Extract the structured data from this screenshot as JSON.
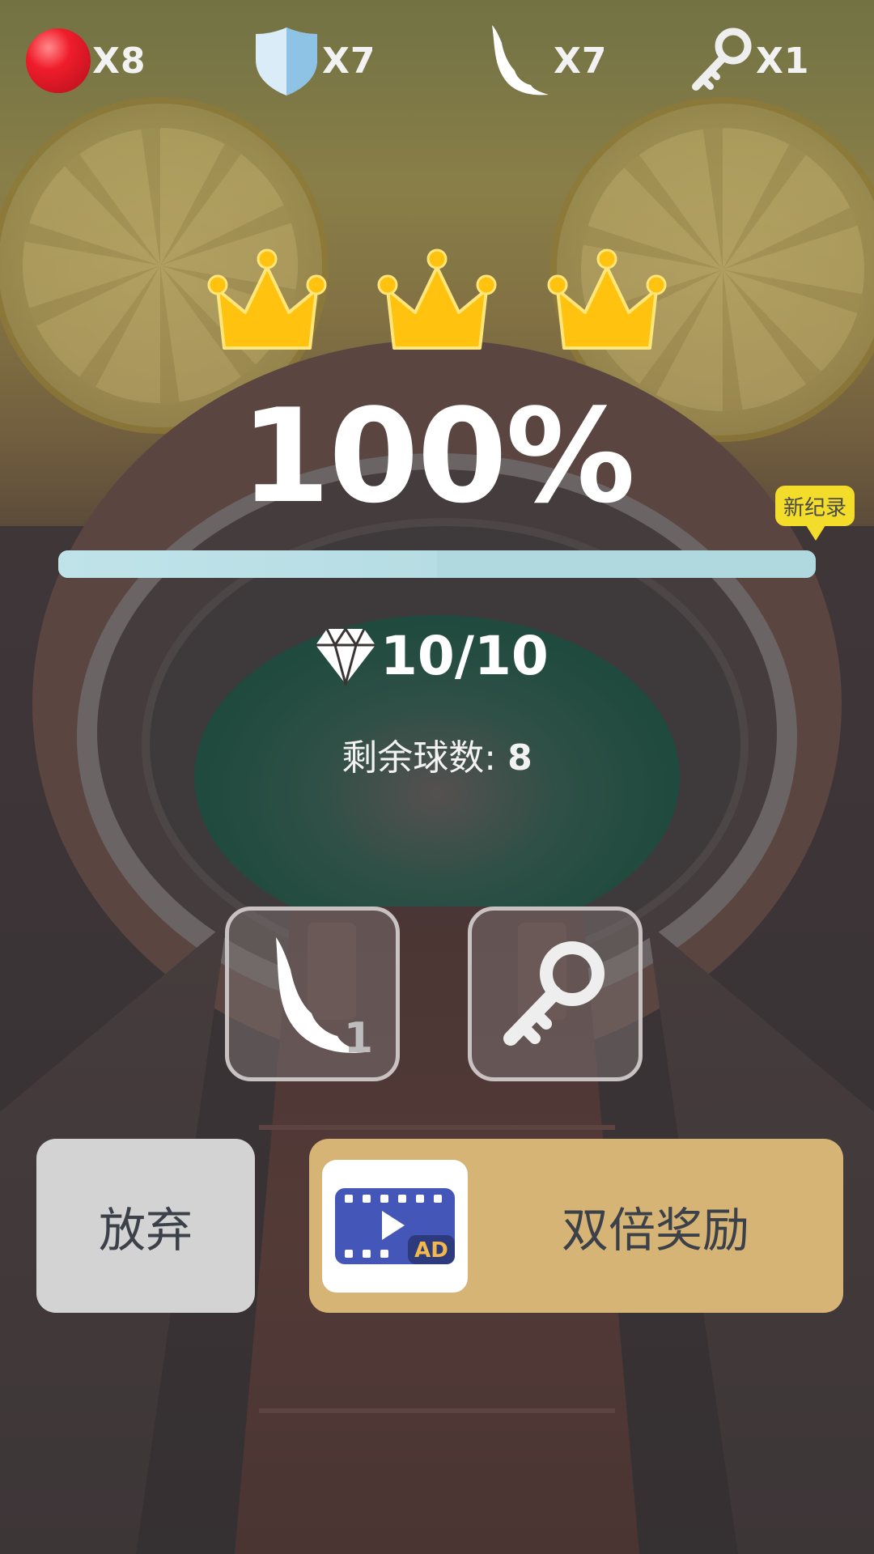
{
  "inventory": {
    "balls": "X8",
    "shields": "X7",
    "wings": "X7",
    "keys": "X1"
  },
  "result": {
    "crowns_earned": 3,
    "crowns_total": 3,
    "percent": "100%",
    "new_record_label": "新纪录",
    "progress_fraction": 1.0,
    "gems": "10/10",
    "remaining_label": "剩余球数:",
    "remaining_value": "8"
  },
  "powerups": {
    "wing_count": "1"
  },
  "buttons": {
    "give_up": "放弃",
    "double_reward": "双倍奖励",
    "ad_badge": "AD"
  },
  "colors": {
    "crown": "#ffc20e",
    "progress": "#a9d7df",
    "record_bubble": "#f3dc2a",
    "double_button": "#d6b476",
    "giveup_button": "#d4d3d4",
    "ad_icon": "#4457b8"
  },
  "icons": [
    "red-ball-icon",
    "shield-icon",
    "wing-icon",
    "key-icon",
    "crown-icon",
    "diamond-icon",
    "video-ad-icon"
  ]
}
